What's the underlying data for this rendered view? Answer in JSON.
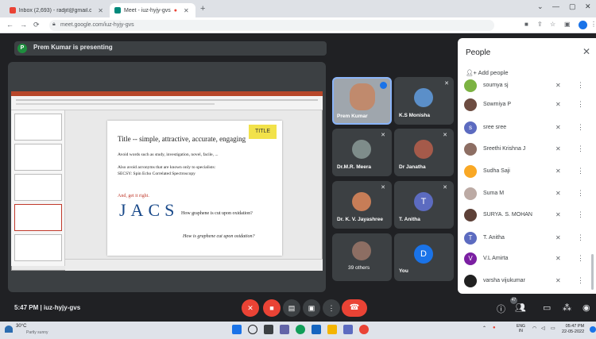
{
  "browser": {
    "tabs": [
      {
        "label": "Inbox (2,693) - radjit@gmail.com"
      },
      {
        "label": "Meet - iuz-hyjy-gvs"
      }
    ],
    "url": "meet.google.com/iuz-hyjy-gvs"
  },
  "meet": {
    "presenter_initial": "P",
    "presenting_label": "Prem Kumar is presenting",
    "time_code": "5:47 PM  |  iuz-hyjy-gvs",
    "people_badge": "47"
  },
  "slide": {
    "title": "Title -- simple, attractive, accurate, engaging",
    "title_tag": "TITLE",
    "line1": "Avoid words such as study, investigation, novel, facile, ...",
    "line2": "Also avoid acronyms that are known only to specialists:",
    "line3": "SECSY: Spin Echo Correlated Spectroscopy",
    "red": "And, get it right.",
    "journal": "JACS",
    "question1": "How graphene is cut upon oxidation?",
    "question2": "How is graphene cut upon oxidation?"
  },
  "tiles": [
    {
      "name": "Prem Kumar"
    },
    {
      "name": "K.S Monisha"
    },
    {
      "name": "Dr.M.R. Meera"
    },
    {
      "name": "Dr Janatha"
    },
    {
      "name": "Dr. K. V. Jayashree"
    },
    {
      "name": "T. Anitha",
      "initial": "T"
    },
    {
      "name": "39 others"
    },
    {
      "name": "You",
      "initial": "D"
    }
  ],
  "panel": {
    "title": "People",
    "add_people": "Add people",
    "people": [
      {
        "name": "soumya sj",
        "color": "#7cb342"
      },
      {
        "name": "Sowmiya P",
        "color": "#6d4c41"
      },
      {
        "name": "sree sree",
        "color": "#5c6bc0",
        "initial": "s"
      },
      {
        "name": "Sreethi Krishna J",
        "color": "#8d6e63"
      },
      {
        "name": "Sudha Saji",
        "color": "#f9a825"
      },
      {
        "name": "Suma M",
        "color": "#bcaaa4"
      },
      {
        "name": "SURYA. S. MOHAN",
        "color": "#5d4037"
      },
      {
        "name": "T. Anitha",
        "color": "#5c6bc0",
        "initial": "T"
      },
      {
        "name": "V.L Amirta",
        "color": "#7b1fa2",
        "initial": "V"
      },
      {
        "name": "varsha vijukumar",
        "color": "#212121"
      }
    ]
  },
  "taskbar": {
    "temp": "30°C",
    "weather": "Partly sunny",
    "lang": "ENG",
    "lang2": "IN",
    "time": "05:47 PM",
    "date": "22-05-2022"
  },
  "colors": {
    "accent": "#1a73e8",
    "danger": "#ea4335",
    "surface": "#3c4043"
  }
}
